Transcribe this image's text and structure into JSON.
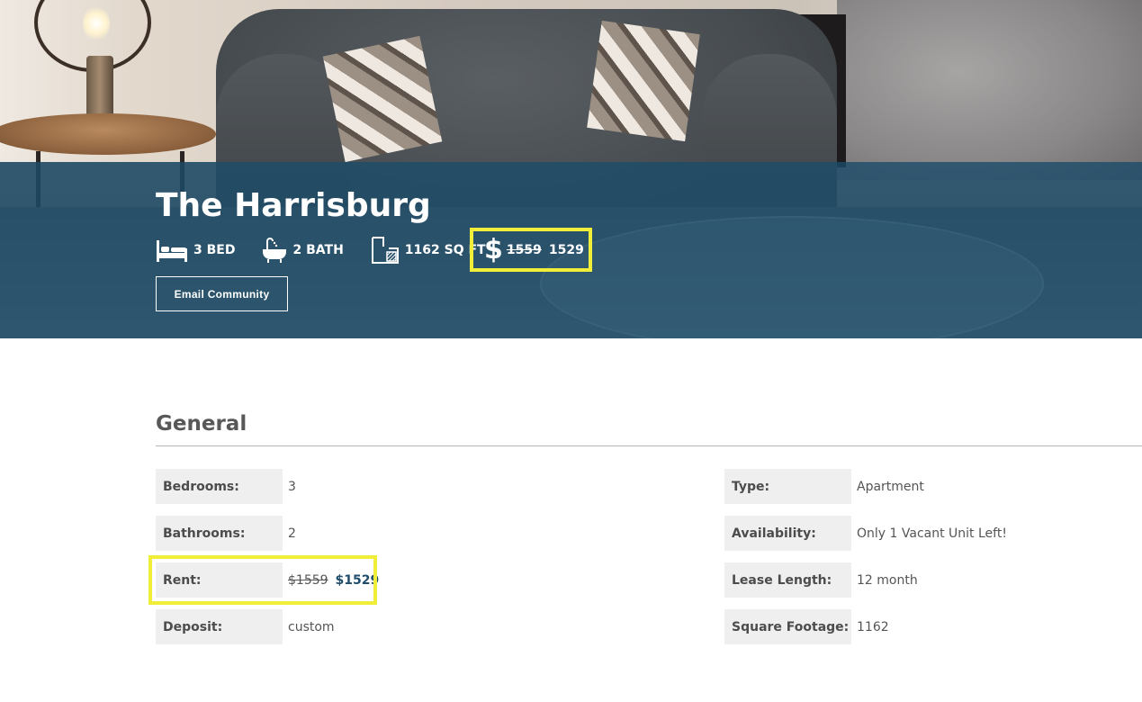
{
  "hero": {
    "title": "The Harrisburg",
    "stats": {
      "beds": "3 BED",
      "baths": "2 BATH",
      "sqft": "1162 SQ FT"
    },
    "price": {
      "symbol": "$",
      "old": "1559",
      "new": "1529"
    },
    "email_button": "Email Community",
    "overlay_color": "#1b4c6a",
    "highlight_color": "#f1ee3a"
  },
  "general": {
    "title": "General",
    "left": [
      {
        "label": "Bedrooms:",
        "value": "3"
      },
      {
        "label": "Bathrooms:",
        "value": "2"
      },
      {
        "label": "Rent:",
        "value_old": "$1559",
        "value_new": "$1529"
      },
      {
        "label": "Deposit:",
        "value": "custom"
      }
    ],
    "right": [
      {
        "label": "Type:",
        "value": "Apartment"
      },
      {
        "label": "Availability:",
        "value": "Only 1 Vacant Unit Left!"
      },
      {
        "label": "Lease Length:",
        "value": "12 month"
      },
      {
        "label": "Square Footage:",
        "value": "1162"
      }
    ]
  },
  "icons": [
    "bed-icon",
    "bath-icon",
    "floorplan-icon",
    "dollar-icon"
  ]
}
